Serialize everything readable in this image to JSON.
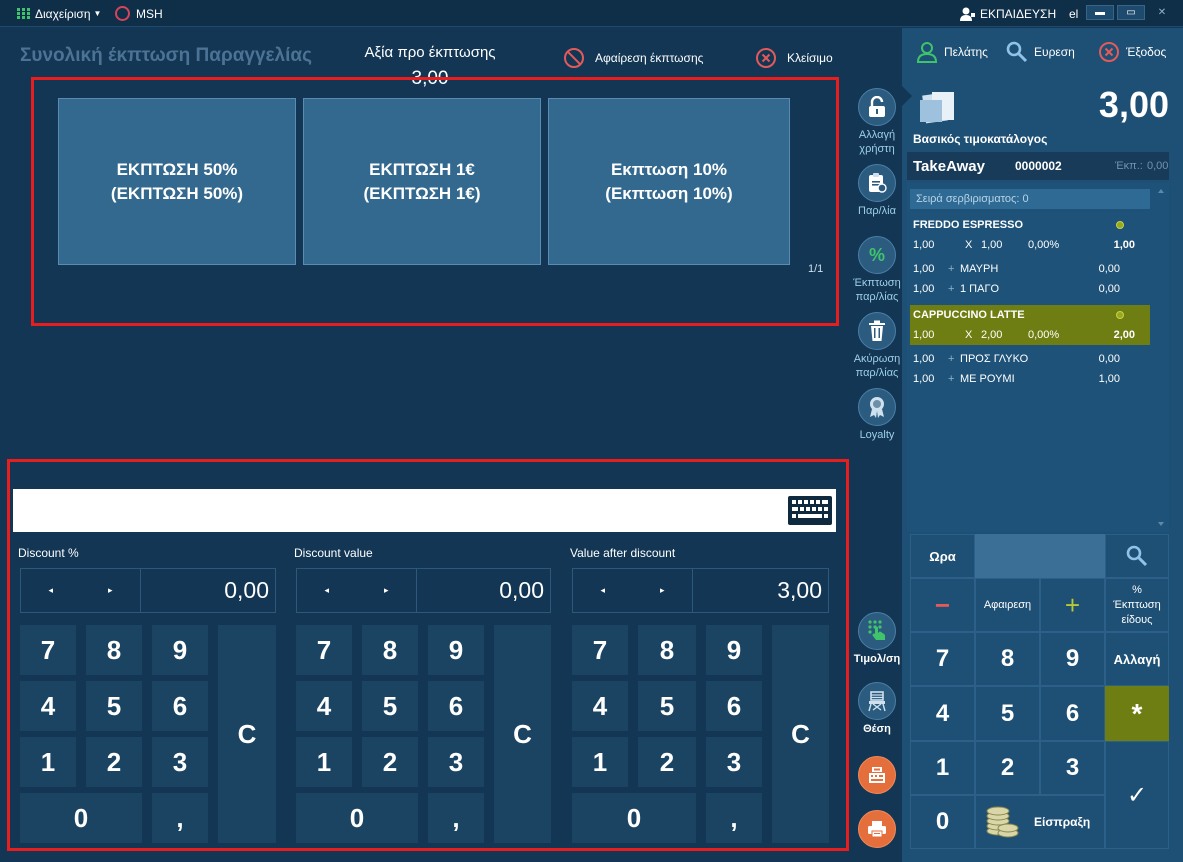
{
  "topbar": {
    "menu_label": "Διαχείριση",
    "station_label": "MSH",
    "user_label": "ΕΚΠΑΙΔΕΥΣΗ",
    "language": "el",
    "window_buttons": [
      "▬",
      "▭",
      "✕"
    ]
  },
  "discount": {
    "title": "Συνολική έκπτωση Παραγγελίας",
    "value_before_label": "Αξία προ έκπτωσης",
    "value_before": "3,00",
    "remove_label": "Αφαίρεση έκπτωσης",
    "close_label": "Κλείσιμο",
    "options": [
      {
        "line1": "ΕΚΠΤΩΣΗ 50%",
        "line2": "(ΕΚΠΤΩΣΗ 50%)"
      },
      {
        "line1": "ΕΚΠΤΩΣΗ 1€",
        "line2": "(ΕΚΠΤΩΣΗ 1€)"
      },
      {
        "line1": "Εκπτωση 10%",
        "line2": "(Εκπτωση 10%)"
      }
    ],
    "page_indicator": "1/1"
  },
  "calculator": {
    "input_value": "",
    "fields": [
      {
        "label": "Discount %",
        "value": "0,00"
      },
      {
        "label": "Discount value",
        "value": "0,00"
      },
      {
        "label": "Value after discount",
        "value": "3,00"
      }
    ],
    "step_left": "◂",
    "step_right": "▸",
    "keys": {
      "k7": "7",
      "k8": "8",
      "k9": "9",
      "k4": "4",
      "k5": "5",
      "k6": "6",
      "k1": "1",
      "k2": "2",
      "k3": "3",
      "k0": "0",
      "comma": ",",
      "clear": "C"
    }
  },
  "side_actions": {
    "change_user": "Αλλαγή χρήστη",
    "orders": "Παρ/λία",
    "order_discount": "Έκπτωση παρ/λίας",
    "cancel_order": "Ακύρωση παρ/λίας",
    "loyalty": "Loyalty",
    "invoice": "Τιμολ/ση",
    "table": "Θέση"
  },
  "right_panel": {
    "customer_label": "Πελάτης",
    "search_label": "Ευρεση",
    "exit_label": "Έξοδος",
    "total": "3,00",
    "pricelist": "Βασικός τιμοκατάλογος",
    "order_type": "TakeAway",
    "order_number": "0000002",
    "discount_label": "Έκπ.:",
    "discount_value": "0,00",
    "serving_order": "Σειρά σερβιρισματος: 0",
    "items": [
      {
        "name": "FREDDO ESPRESSO",
        "qty": "1,00",
        "x": "X",
        "price": "1,00",
        "disc": "0,00%",
        "total": "1,00",
        "modifiers": [
          {
            "qty": "1,00",
            "sign": "+",
            "name": "ΜΑΥΡΗ",
            "price": "0,00"
          },
          {
            "qty": "1,00",
            "sign": "+",
            "name": "1 ΠΑΓΟ",
            "price": "0,00"
          }
        ]
      },
      {
        "name": "CAPPUCCINO LATTE",
        "qty": "1,00",
        "x": "X",
        "price": "2,00",
        "disc": "0,00%",
        "total": "2,00",
        "modifiers": [
          {
            "qty": "1,00",
            "sign": "+",
            "name": "ΠΡΟΣ ΓΛΥΚΟ",
            "price": "0,00"
          },
          {
            "qty": "1,00",
            "sign": "+",
            "name": "ΜΕ ΡΟΥΜΙ",
            "price": "1,00"
          }
        ]
      }
    ],
    "keypad": {
      "time_label": "Ωρα",
      "minus": "−",
      "remove": "Αφαιρεση",
      "plus": "+",
      "item_discount": "% Έκπτωση είδους",
      "k7": "7",
      "k8": "8",
      "k9": "9",
      "change": "Αλλαγή",
      "k4": "4",
      "k5": "5",
      "k6": "6",
      "star": "*",
      "k1": "1",
      "k2": "2",
      "k3": "3",
      "k0": "0",
      "collect": "Είσπραξη",
      "confirm": "✓"
    }
  },
  "colors": {
    "background": "#123654",
    "panel": "#1e4f74",
    "accent_green": "#6e7e12",
    "highlight_red": "#e81e1e",
    "orange": "#e56f3c"
  }
}
